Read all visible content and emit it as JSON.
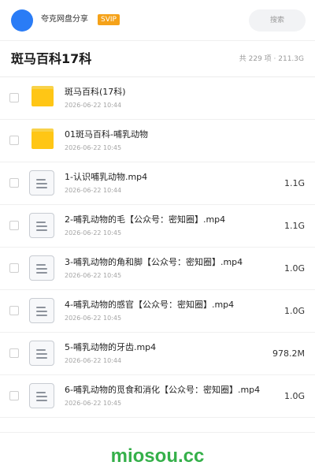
{
  "header": {
    "app_title": "夸克网盘分享",
    "badge": "SVIP",
    "search_placeholder": "搜索"
  },
  "folder": {
    "title": "斑马百科17科",
    "summary": "共 229 项 · 211.3G"
  },
  "items": [
    {
      "type": "folder",
      "name": "斑马百科(17科)",
      "date": "2026-06-22 10:44",
      "size": ""
    },
    {
      "type": "folder",
      "name": "01斑马百科-哺乳动物",
      "date": "2026-06-22 10:45",
      "size": ""
    },
    {
      "type": "file",
      "name": "1-认识哺乳动物.mp4",
      "date": "2026-06-22 10:44",
      "size": "1.1G"
    },
    {
      "type": "file",
      "name": "2-哺乳动物的毛【公众号：密知圈】.mp4",
      "date": "2026-06-22 10:45",
      "size": "1.1G"
    },
    {
      "type": "file",
      "name": "3-哺乳动物的角和脚【公众号：密知圈】.mp4",
      "date": "2026-06-22 10:45",
      "size": "1.0G"
    },
    {
      "type": "file",
      "name": "4-哺乳动物的感官【公众号：密知圈】.mp4",
      "date": "2026-06-22 10:45",
      "size": "1.0G"
    },
    {
      "type": "file",
      "name": "5-哺乳动物的牙齿.mp4",
      "date": "2026-06-22 10:44",
      "size": "978.2M"
    },
    {
      "type": "file",
      "name": "6-哺乳动物的觅食和消化【公众号：密知圈】.mp4",
      "date": "2026-06-22 10:45",
      "size": "1.0G"
    }
  ],
  "watermark": "miosou.cc",
  "colors": {
    "accent": "#2a7cf6",
    "badge": "#f5a219",
    "folder": "#ffc615",
    "watermark": "#35b04a"
  }
}
